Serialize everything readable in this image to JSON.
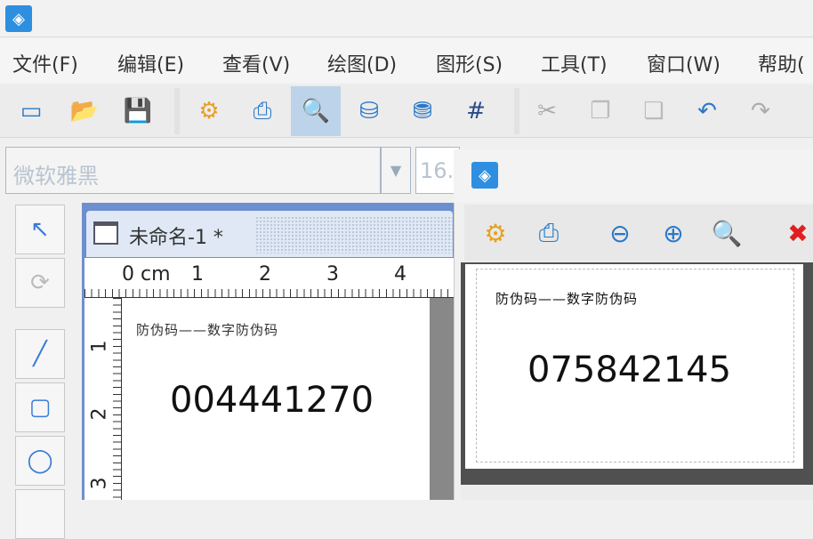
{
  "menu": [
    "文件(F)",
    "编辑(E)",
    "查看(V)",
    "绘图(D)",
    "图形(S)",
    "工具(T)",
    "窗口(W)",
    "帮助("
  ],
  "toolbar": {
    "icons": [
      "new-icon",
      "open-icon",
      "save-icon",
      "settings-icon",
      "print-icon",
      "print-preview-icon",
      "database-icon",
      "database-connect-icon",
      "grid-icon",
      "cut-icon",
      "copy-icon",
      "paste-icon",
      "undo-icon",
      "redo-icon"
    ],
    "selected": "print-preview-icon"
  },
  "font": {
    "family": "微软雅黑",
    "size": "16."
  },
  "tools": [
    "select-arrow-icon",
    "rotate-icon",
    "line-icon",
    "rounded-rect-icon",
    "ellipse-icon"
  ],
  "document": {
    "tab_title": "未命名-1 *",
    "ruler_unit": "0 cm",
    "h_ticks": [
      "1",
      "2",
      "3",
      "4"
    ],
    "v_ticks": [
      "1",
      "2",
      "3"
    ],
    "caption": "防伪码——数字防伪码",
    "code": "004441270"
  },
  "preview": {
    "toolbar": [
      "settings-icon",
      "print-icon",
      "zoom-out-icon",
      "zoom-in-icon",
      "zoom-fit-icon",
      "close-icon"
    ],
    "caption": "防伪码——数字防伪码",
    "code": "075842145"
  },
  "colors": {
    "accent": "#6d8fcf",
    "selected": "#bcd3ea"
  }
}
